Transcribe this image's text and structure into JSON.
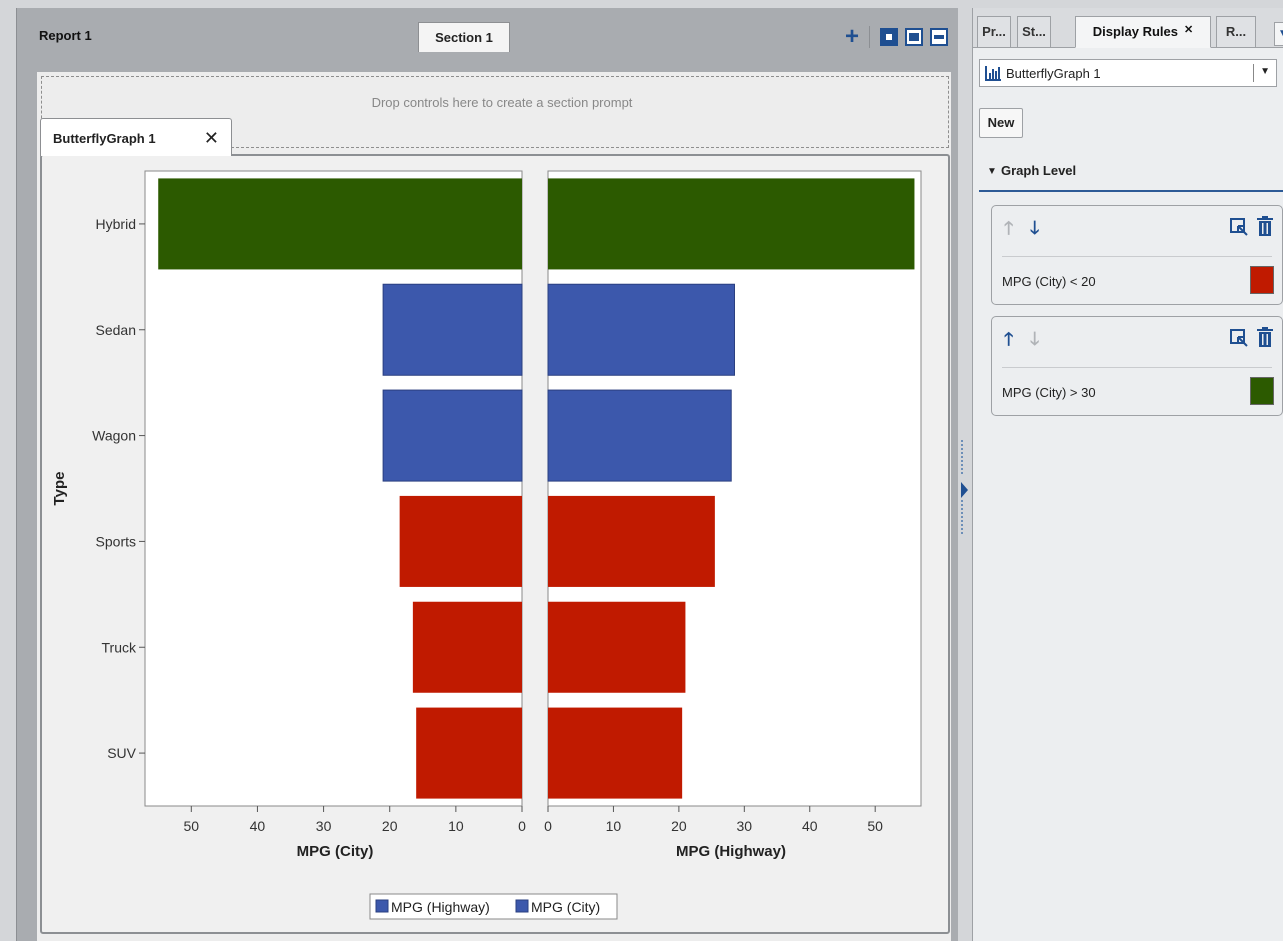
{
  "report": {
    "title": "Report 1",
    "section_tab": "Section 1",
    "drop_prompt": "Drop controls here to create a section prompt",
    "object_tab": "ButterflyGraph 1",
    "object_tab_close": "✕"
  },
  "right_panel": {
    "tabs": [
      {
        "label": "Pr...",
        "active": false
      },
      {
        "label": "St...",
        "active": false
      },
      {
        "label": "Display Rules",
        "active": true,
        "close": "✕"
      },
      {
        "label": "R...",
        "active": false
      }
    ],
    "object_selector": "ButterflyGraph 1",
    "new_button": "New",
    "graph_level_label": "Graph Level",
    "rules": [
      {
        "condition": "MPG (City) < 20",
        "color": "#c01a00",
        "up_enabled": false,
        "down_enabled": true
      },
      {
        "condition": "MPG (City) > 30",
        "color": "#2c5a00",
        "up_enabled": true,
        "down_enabled": false
      }
    ]
  },
  "chart_data": {
    "type": "bar",
    "orientation": "butterfly",
    "categories": [
      "Hybrid",
      "Sedan",
      "Wagon",
      "Sports",
      "Truck",
      "SUV"
    ],
    "y_axis_label": "Type",
    "left": {
      "name": "MPG (City)",
      "xlabel": "MPG (City)",
      "values": [
        55,
        21,
        21,
        18.5,
        16.5,
        16
      ],
      "xlim": [
        0,
        57
      ],
      "ticks": [
        0,
        10,
        20,
        30,
        40,
        50
      ]
    },
    "right": {
      "name": "MPG (Highway)",
      "xlabel": "MPG (Highway)",
      "values": [
        56,
        28.5,
        28,
        25.5,
        21,
        20.5
      ],
      "xlim": [
        0,
        57
      ],
      "ticks": [
        0,
        10,
        20,
        30,
        40,
        50
      ]
    },
    "bar_colors": [
      "#2c5a00",
      "#3c58ac",
      "#3c58ac",
      "#c01a00",
      "#c01a00",
      "#c01a00"
    ],
    "legend": [
      {
        "label": "MPG (Highway)",
        "color": "#3c58ac"
      },
      {
        "label": "MPG (City)",
        "color": "#3c58ac"
      }
    ],
    "legend_position": "bottom"
  }
}
